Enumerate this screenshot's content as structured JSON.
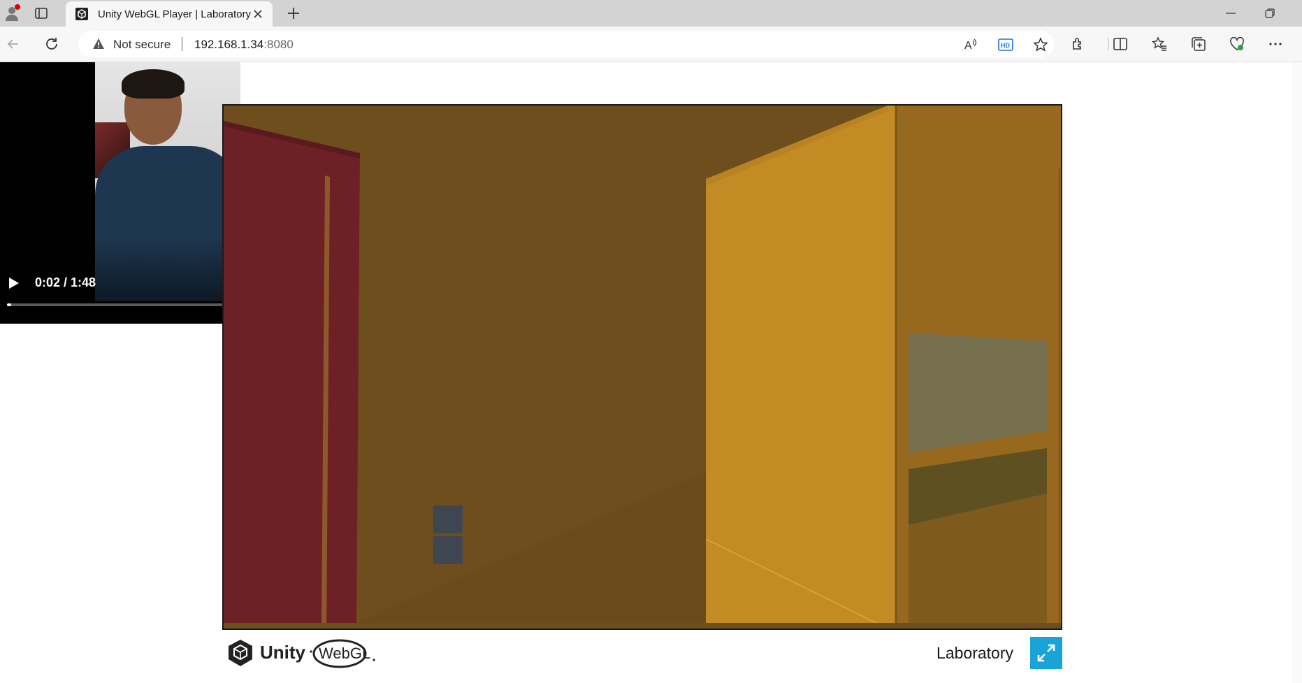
{
  "browser": {
    "tab_title": "Unity WebGL Player | Laboratory",
    "security_label": "Not secure",
    "url_host": "192.168.1.34",
    "url_port": ":8080"
  },
  "video": {
    "time": "0:02 / 1:48",
    "progress": 0.0185
  },
  "unity": {
    "product_name": "Laboratory",
    "logo_unity": "Unity",
    "logo_webgl": "WebGL"
  },
  "colors": {
    "fullscreen_button": "#1aa3d6",
    "wall": "#6e4e1c",
    "cabinet": "#c38b24",
    "door": "#6d2127"
  }
}
